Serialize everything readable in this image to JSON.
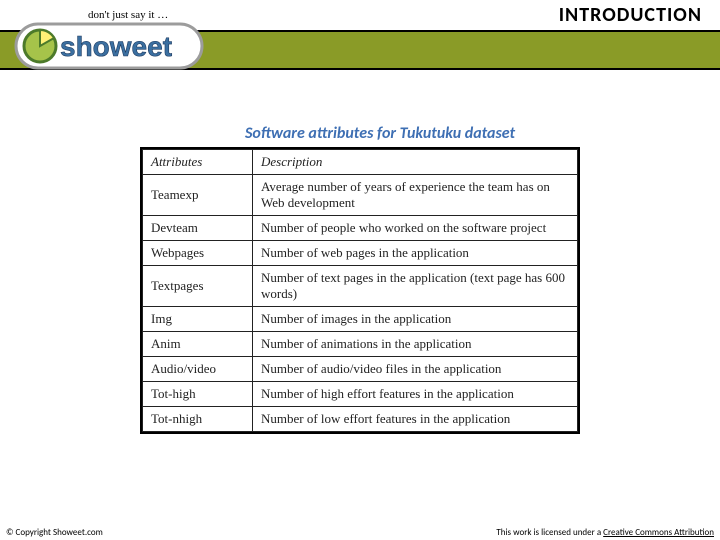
{
  "header": {
    "title": "INTRODUCTION",
    "logo": {
      "brand": "showeet",
      "tagline": "don't just say it ..."
    }
  },
  "caption": "Software attributes for Tukutuku dataset",
  "table": {
    "headers": {
      "attr": "Attributes",
      "desc": "Description"
    },
    "rows": [
      {
        "attr": "Teamexp",
        "desc": "Average number of years of experience the team has on Web development"
      },
      {
        "attr": "Devteam",
        "desc": "Number of people who worked on the software project"
      },
      {
        "attr": "Webpages",
        "desc": "Number of web pages in the application"
      },
      {
        "attr": "Textpages",
        "desc": "Number of text pages in the application (text page has 600 words)"
      },
      {
        "attr": "Img",
        "desc": "Number of images in the application"
      },
      {
        "attr": "Anim",
        "desc": "Number of animations in the application"
      },
      {
        "attr": "Audio/video",
        "desc": "Number of audio/video files in the application"
      },
      {
        "attr": "Tot-high",
        "desc": "Number of high effort features in the application"
      },
      {
        "attr": "Tot-nhigh",
        "desc": "Number of low effort features in the application"
      }
    ]
  },
  "footer": {
    "copyright": "© Copyright Showeet.com",
    "license_prefix": "This work is licensed under a ",
    "license_link": "Creative Commons Attribution"
  }
}
